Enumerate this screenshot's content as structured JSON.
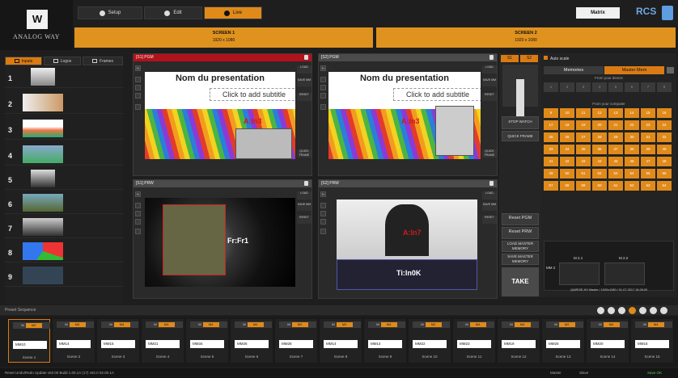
{
  "header": {
    "logo_text": "ANALOG WAY",
    "tabs": [
      "Setup",
      "Edit",
      "Live"
    ],
    "active_tab": "Live",
    "screens": [
      {
        "name": "SCREEN 1",
        "res": "1920 x 1080"
      },
      {
        "name": "SCREEN 2",
        "res": "1920 x 1080"
      }
    ],
    "matrix": "Matrix",
    "rcs": "RCS"
  },
  "left": {
    "tabs": [
      "Inputs",
      "Logos",
      "Frames"
    ],
    "inputs": [
      "1",
      "2",
      "3",
      "4",
      "5",
      "6",
      "7",
      "8",
      "9"
    ]
  },
  "panels": {
    "s1_pgm": "[S1] PGM",
    "s2_pgm": "[S2] PGM",
    "s1_prw": "[S1] PRW",
    "s2_prw": "[S2] PRW",
    "slide_title": "Nom du presentation",
    "slide_sub": "Click to add subtitle",
    "lbl_s1": "A:In3",
    "lbl_s2": "A:In3",
    "lbl_prw1": "Fr:Fr1",
    "lbl_prw2": "A:In7",
    "lbl_prw3": "Ti:In0K",
    "side_load": "LOAD",
    "side_save": "SAVE MM",
    "side_reset": "RESET",
    "side_quick": "QUICK FRAME"
  },
  "control": {
    "s1": "S1",
    "s2": "S2",
    "stop": "STOP WATCH",
    "quick_frame": "QUICK FRAME",
    "reset_pgm": "Reset PGM",
    "reset_prw": "Reset PRW",
    "load_mm": "LOAD MASTER MEMORY",
    "save_mm": "SAVE MASTER MEMORY",
    "take": "TAKE"
  },
  "memories": {
    "auto_scale": "Auto scale",
    "tabs": [
      "Memories",
      "Master Mem"
    ],
    "from_device": "From your device",
    "from_computer": "From your computer",
    "device_nums": [
      "1",
      "2",
      "3",
      "4",
      "5",
      "6",
      "7",
      "8"
    ],
    "computer_nums": [
      "9",
      "10",
      "11",
      "12",
      "13",
      "14",
      "15",
      "16",
      "17",
      "18",
      "19",
      "20",
      "21",
      "22",
      "23",
      "24",
      "25",
      "26",
      "27",
      "28",
      "29",
      "30",
      "31",
      "32",
      "33",
      "34",
      "35",
      "36",
      "37",
      "38",
      "39",
      "40",
      "41",
      "42",
      "43",
      "44",
      "45",
      "46",
      "47",
      "48",
      "49",
      "50",
      "51",
      "52",
      "53",
      "54",
      "55",
      "56",
      "57",
      "58",
      "59",
      "60",
      "61",
      "62",
      "63",
      "64"
    ],
    "mm_labels": [
      "MM 2",
      "M 2.1",
      "M 2.2"
    ],
    "footer": "QAIRISE-HV Master / 1920x1080 / 01-07-2017 16:28:09"
  },
  "preset": {
    "title": "Preset Sequence",
    "scenes": [
      {
        "tag": "M2",
        "value": "MM10",
        "label": "Scene 1"
      },
      {
        "tag": "M4",
        "value": "MM14",
        "label": "Scene 2"
      },
      {
        "tag": "M4",
        "value": "MM15",
        "label": "Scene 3"
      },
      {
        "tag": "M4",
        "value": "MM21",
        "label": "Scene 4"
      },
      {
        "tag": "M4",
        "value": "MM34",
        "label": "Scene 5"
      },
      {
        "tag": "M4",
        "value": "MM26",
        "label": "Scene 6"
      },
      {
        "tag": "M2",
        "value": "MM28",
        "label": "Scene 7"
      },
      {
        "tag": "M2",
        "value": "MM14",
        "label": "Scene 8"
      },
      {
        "tag": "M4",
        "value": "MM14",
        "label": "Scene 9"
      },
      {
        "tag": "M2",
        "value": "MM22",
        "label": "Scene 10"
      },
      {
        "tag": "M4",
        "value": "MM23",
        "label": "Scene 11"
      },
      {
        "tag": "M4",
        "value": "MM19",
        "label": "Scene 12"
      },
      {
        "tag": "M2",
        "value": "MM25",
        "label": "Scene 13"
      },
      {
        "tag": "M4",
        "value": "MM20",
        "label": "Scene 14"
      },
      {
        "tag": "M4",
        "value": "MM16",
        "label": "Scene 15"
      }
    ]
  },
  "status": {
    "left": "Reset   Undo/Redo   Update   v02.00 Build 1.00.1A (17)   v02.0 02.00.1A",
    "right1": "Master",
    "right2": "Slave",
    "right3": "Save OK"
  }
}
